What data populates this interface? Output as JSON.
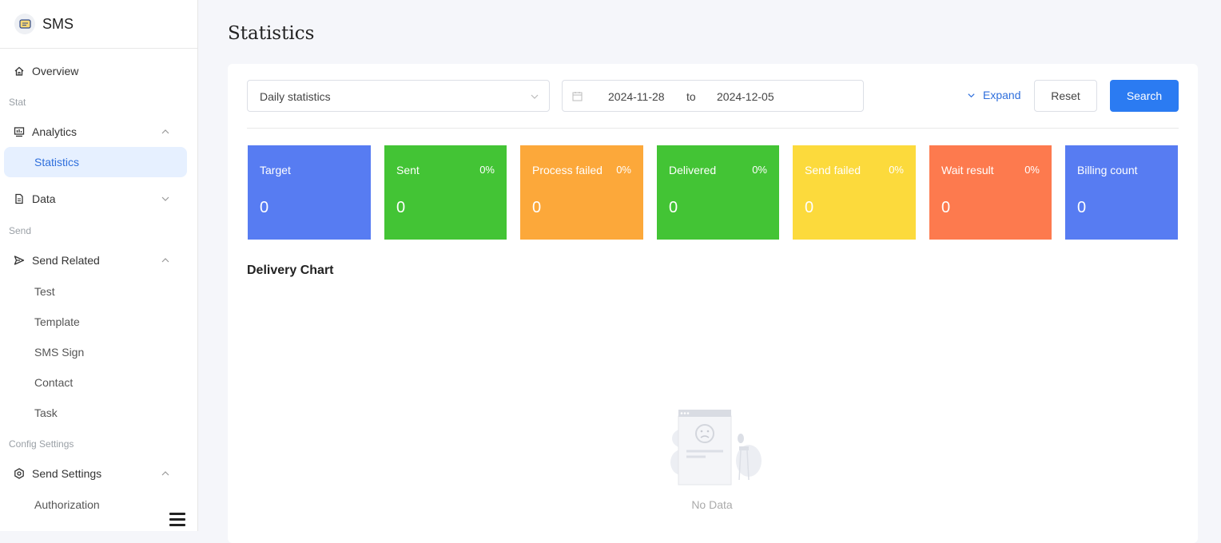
{
  "app": {
    "name": "SMS"
  },
  "sidebar": {
    "overview": "Overview",
    "section_stat": "Stat",
    "analytics": "Analytics",
    "statistics": "Statistics",
    "data": "Data",
    "section_send": "Send",
    "send_related": "Send Related",
    "send_related_items": [
      "Test",
      "Template",
      "SMS Sign",
      "Contact",
      "Task"
    ],
    "section_config": "Config Settings",
    "send_settings": "Send Settings",
    "authorization": "Authorization"
  },
  "page": {
    "title": "Statistics"
  },
  "filters": {
    "type_value": "Daily statistics",
    "date_start": "2024-11-28",
    "date_sep": "to",
    "date_end": "2024-12-05",
    "expand_label": "Expand",
    "reset_label": "Reset",
    "search_label": "Search"
  },
  "stats": [
    {
      "title": "Target",
      "percent": "",
      "value": "0",
      "color": "#577cf2"
    },
    {
      "title": "Sent",
      "percent": "0%",
      "value": "0",
      "color": "#43c435"
    },
    {
      "title": "Process failed",
      "percent": "0%",
      "value": "0",
      "color": "#fca83a"
    },
    {
      "title": "Delivered",
      "percent": "0%",
      "value": "0",
      "color": "#43c435"
    },
    {
      "title": "Send failed",
      "percent": "0%",
      "value": "0",
      "color": "#fcda3c"
    },
    {
      "title": "Wait result",
      "percent": "0%",
      "value": "0",
      "color": "#fd7a4e"
    },
    {
      "title": "Billing count",
      "percent": "",
      "value": "0",
      "color": "#577cf2"
    }
  ],
  "chart": {
    "title": "Delivery Chart",
    "empty_text": "No Data"
  }
}
